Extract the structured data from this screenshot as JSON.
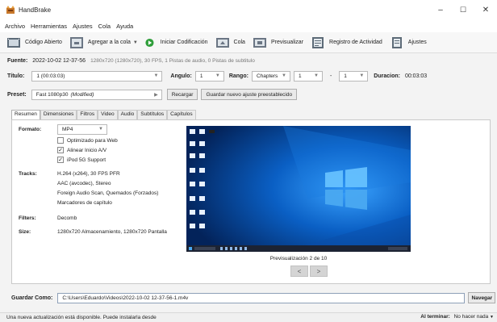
{
  "window": {
    "title": "HandBrake",
    "min": "–",
    "max": "☐",
    "close": "✕"
  },
  "menu": [
    "Archivo",
    "Herramientas",
    "Ajustes",
    "Cola",
    "Ayuda"
  ],
  "toolbar": {
    "source": "Código Abierto",
    "add_queue": "Agregar a la cola",
    "start": "Iniciar Codificación",
    "queue": "Cola",
    "preview": "Previsualizar",
    "activity": "Registro de Actividad",
    "settings": "Ajustes"
  },
  "source": {
    "label": "Fuente:",
    "name": "2022-10-02 12-37-56",
    "info": "1280x720 (1280x720), 30 FPS, 1 Pistas de audio, 0 Pistas de subtitulo"
  },
  "title_row": {
    "label": "Título:",
    "value": "1 (00:03:03)",
    "angle_label": "Angulo:",
    "angle": "1",
    "range_label": "Rango:",
    "range_type": "Chapters",
    "range_start": "1",
    "range_sep": "-",
    "range_end": "1",
    "duration_label": "Duracion:",
    "duration": "00:03:03"
  },
  "preset": {
    "label": "Preset:",
    "value": "Fast 1080p30",
    "modified": "(Modified)",
    "reload": "Recargar",
    "save_new": "Guardar nuevo ajuste preestablecido"
  },
  "tabs": [
    "Resumen",
    "Dimensiones",
    "Filtros",
    "Video",
    "Audio",
    "Subtítulos",
    "Capítulos"
  ],
  "summary": {
    "format_label": "Formato:",
    "format": "MP4",
    "opt_web": "Optimizado para Web",
    "opt_web_checked": false,
    "align_av": "Alinear Inicio A/V",
    "align_av_checked": true,
    "ipod": "iPod 5G Support",
    "ipod_checked": true,
    "tracks_label": "Tracks:",
    "tracks": [
      "H.264 (x264), 30 FPS PFR",
      "AAC (avcodec), Stereo",
      "Foreign Audio Scan, Quemados (Forzados)",
      "Marcadores de capítulo"
    ],
    "filters_label": "Filters:",
    "filters": "Decomb",
    "size_label": "Size:",
    "size": "1280x720 Almacenamiento, 1280x720 Pantalla"
  },
  "preview_caption": "Previsualización 2 de 10",
  "nav": {
    "prev": "<",
    "next": ">"
  },
  "save_as": {
    "label": "Guardar Como:",
    "path": "C:\\Users\\Eduardo\\Videos\\2022-10-02 12-37-56-1.m4v",
    "browse": "Navegar"
  },
  "status": {
    "message": "Una nueva actualización está disponible. Puede instalarla desde",
    "done_label": "Al terminar:",
    "done_value": "No hacer nada"
  },
  "colors": {
    "accent": "#1f7bd6",
    "desktop": "#0a5fc4",
    "start_green": "#2f9e3a"
  }
}
